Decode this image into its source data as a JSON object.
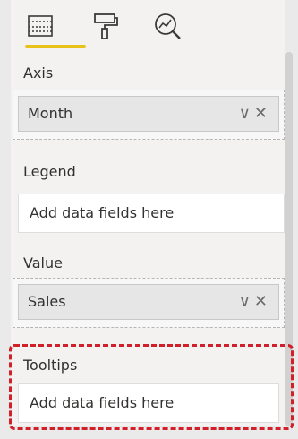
{
  "toolbar": {
    "icons": [
      "fields-icon",
      "format-paint-roller-icon",
      "analytics-magnifier-icon"
    ],
    "active_color": "#e8c21a"
  },
  "axis": {
    "label": "Axis",
    "field": "Month",
    "actions": "∨✕"
  },
  "legend": {
    "label": "Legend",
    "placeholder": "Add data fields here"
  },
  "value": {
    "label": "Value",
    "field": "Sales",
    "actions": "∨✕"
  },
  "tooltips": {
    "label": "Tooltips",
    "placeholder": "Add data fields here",
    "highlight_color": "#d1202a"
  }
}
